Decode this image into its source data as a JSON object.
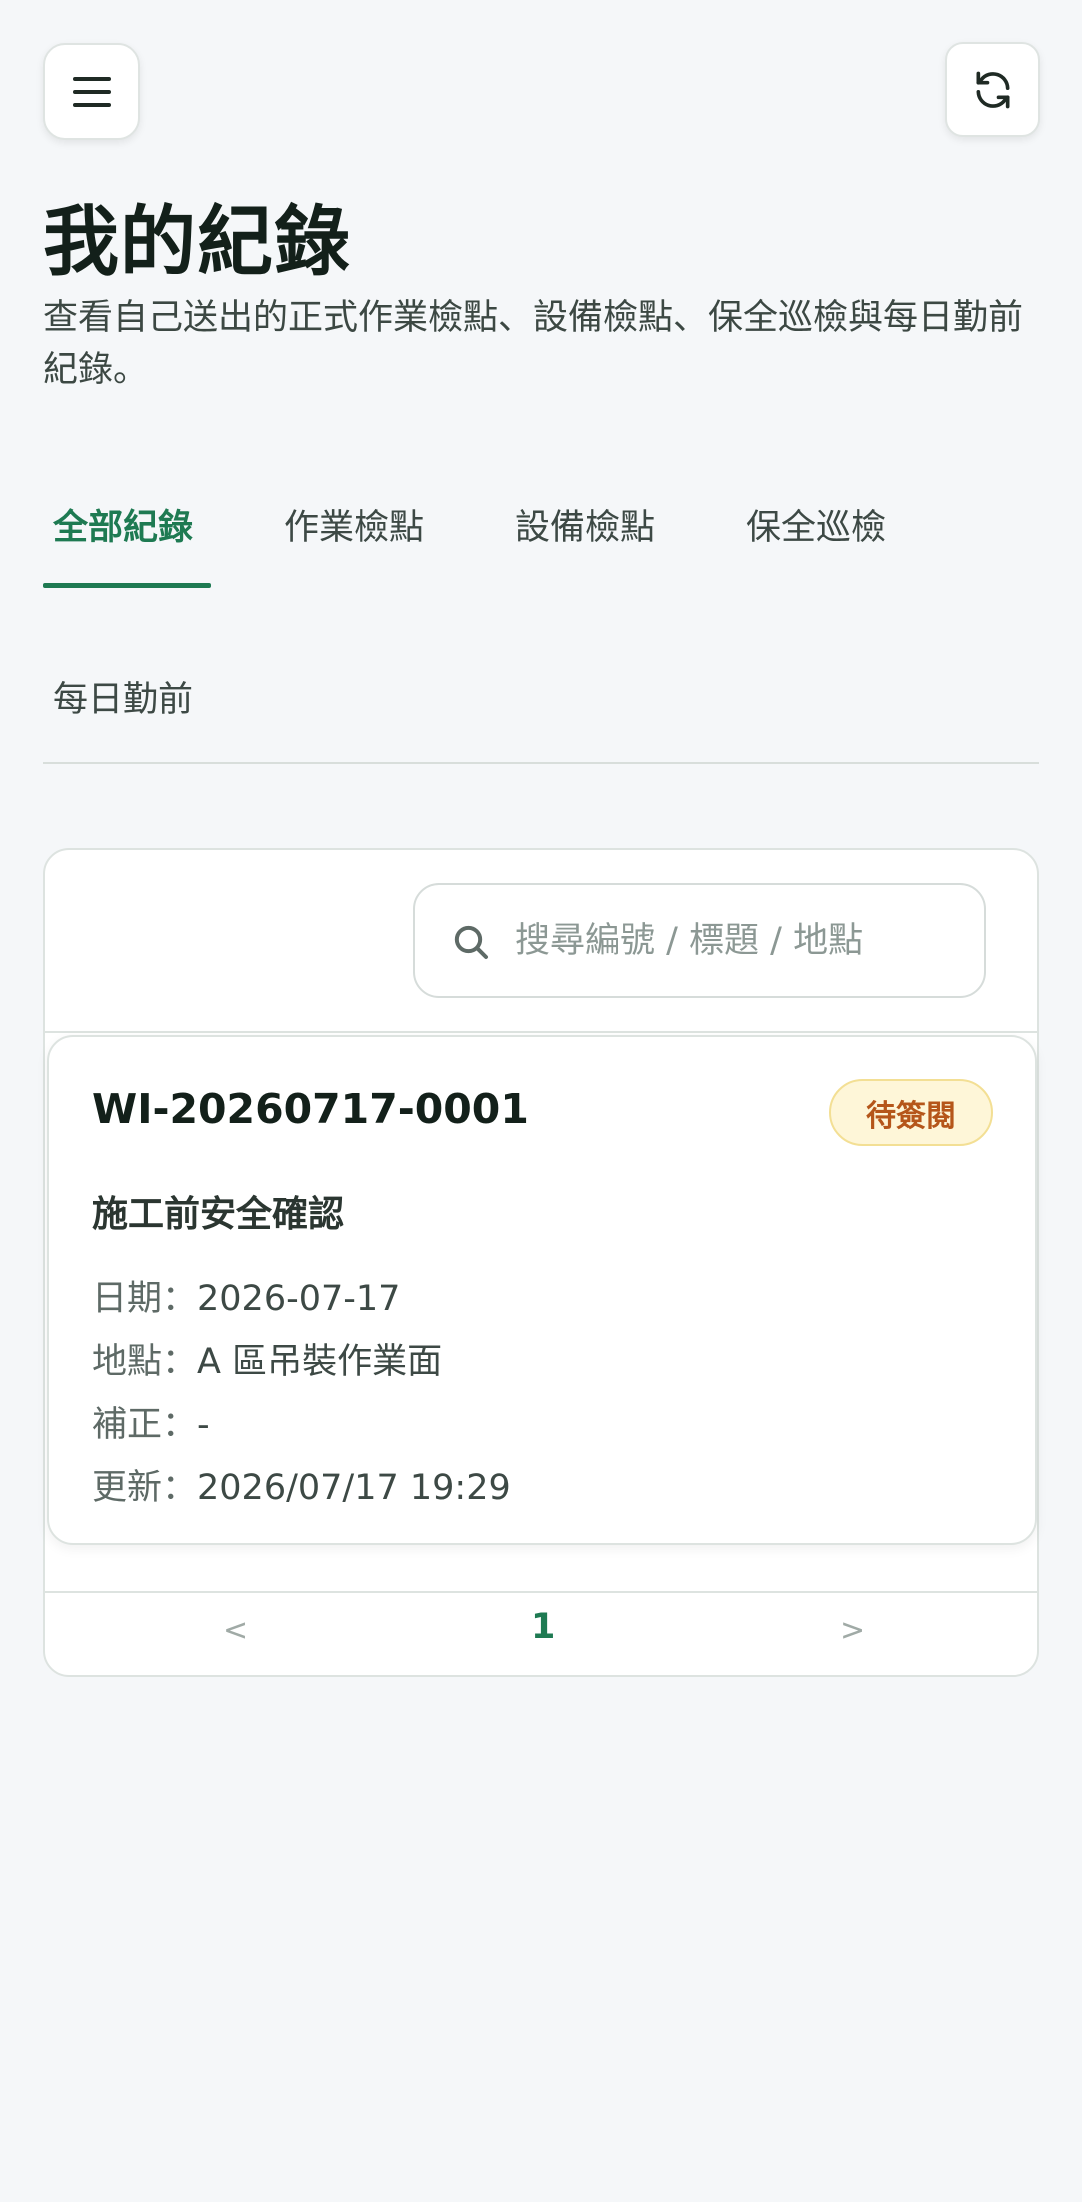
{
  "header": {
    "menu_icon": "hamburger-menu-icon",
    "refresh_icon": "refresh-icon",
    "title": "我的紀錄",
    "description": "查看自己送出的正式作業檢點、設備檢點、保全巡檢與每日勤前紀錄。"
  },
  "tabs": [
    {
      "label": "全部紀錄",
      "active": true
    },
    {
      "label": "作業檢點",
      "active": false
    },
    {
      "label": "設備檢點",
      "active": false
    },
    {
      "label": "保全巡檢",
      "active": false
    },
    {
      "label": "每日勤前",
      "active": false
    }
  ],
  "search": {
    "placeholder": "搜尋編號 / 標題 / 地點",
    "value": ""
  },
  "records": [
    {
      "id": "WI-20260717-0001",
      "status": "待簽閱",
      "title": "施工前安全確認",
      "meta": [
        {
          "key": "日期：",
          "value": "2026-07-17"
        },
        {
          "key": "地點：",
          "value": "A 區吊裝作業面"
        },
        {
          "key": "補正：",
          "value": "-"
        },
        {
          "key": "更新：",
          "value": "2026/07/17 19:29"
        }
      ]
    }
  ],
  "pagination": {
    "prev": "<",
    "current_page": "1",
    "next": ">"
  },
  "colors": {
    "accent": "#1e7a52",
    "background": "#f5f7f9",
    "status_badge_bg": "#fef6d8",
    "status_badge_text": "#b5561a"
  }
}
